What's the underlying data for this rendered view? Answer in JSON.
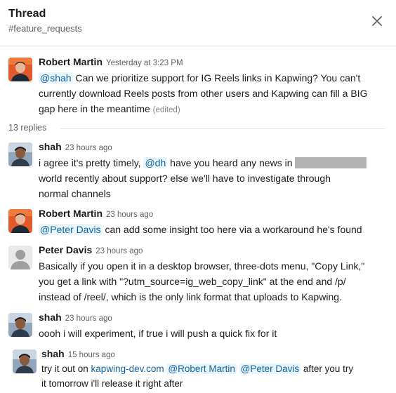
{
  "header": {
    "title": "Thread",
    "channel": "#feature_requests",
    "close_icon": "close-icon"
  },
  "parent": {
    "author": "Robert Martin",
    "time": "Yesterday at 3:23 PM",
    "mention": "@shah",
    "text_1": " Can we prioritize support for IG Reels links in Kapwing? You can't",
    "text_2": "currently download Reels posts from other users and Kapwing can fill a BIG",
    "text_3": "gap here in the meantime ",
    "edited": "(edited)"
  },
  "replies_count": "13 replies",
  "replies": [
    {
      "author": "shah",
      "time": "23 hours ago",
      "line1_pre": "i agree it's pretty timely, ",
      "line1_mention": "@dh",
      "line1_post": " have you heard any news in ",
      "line2": "world recently about support?  else we'll have to investigate through",
      "line3": "normal channels"
    },
    {
      "author": "Robert Martin",
      "time": "23 hours ago",
      "mention": "@Peter Davis",
      "text": " can add some insight too here via a workaround he's found"
    },
    {
      "author": "Peter Davis",
      "time": "23 hours ago",
      "line1": "Basically if you open it in a desktop browser, three-dots menu, \"Copy Link,\"",
      "line2": "you get a link with \"?utm_source=ig_web_copy_link\" at the end and /p/",
      "line3": "instead of /reel/, which is the only link format that uploads to Kapwing."
    },
    {
      "author": "shah",
      "time": "23 hours ago",
      "text": "oooh i will experiment, if true i will push a quick fix for it"
    },
    {
      "author": "shah",
      "time": "15 hours ago",
      "line1_pre": "try it out on ",
      "line1_link": "kapwing-dev.com",
      "line1_mention1": "@Robert Martin",
      "line1_mention2": "@Peter Davis",
      "line1_post": " after you try",
      "line2": "it tomorrow i'll release it right after"
    }
  ]
}
